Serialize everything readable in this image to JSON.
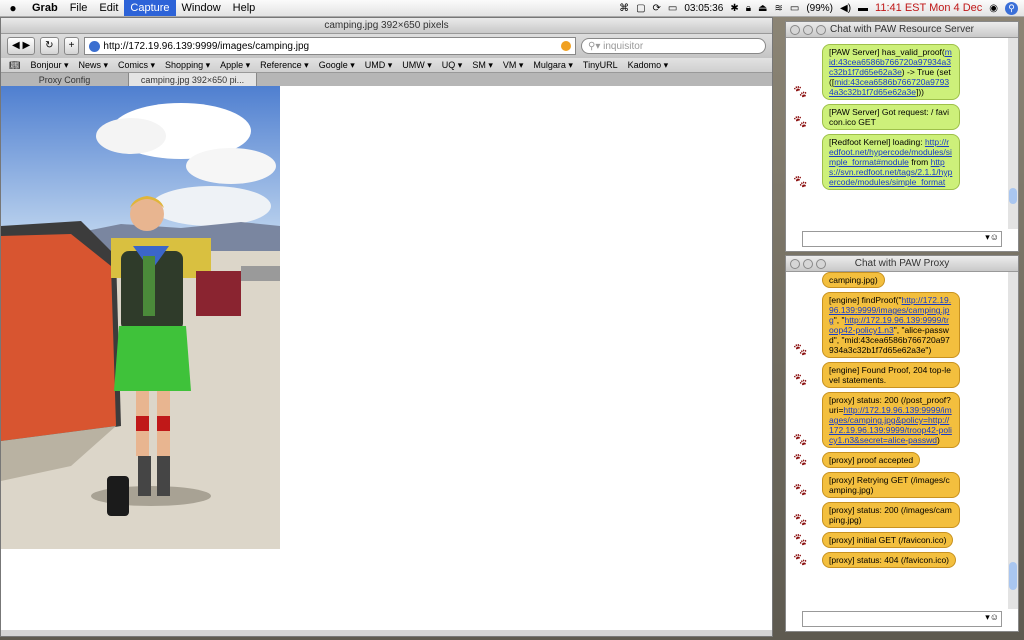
{
  "menubar": {
    "app": "Grab",
    "items": [
      "File",
      "Edit",
      "Capture",
      "Window",
      "Help"
    ],
    "selected_index": 2,
    "time_counter": "03:05:36",
    "battery": "(99%)",
    "clock": "11:41 EST Mon 4 Dec"
  },
  "browser": {
    "title": "camping.jpg 392×650 pixels",
    "url": "http://172.19.96.139:9999/images/camping.jpg",
    "search_placeholder": "inquisitor",
    "bookmarks": [
      "Bonjour ▾",
      "News ▾",
      "Comics ▾",
      "Shopping ▾",
      "Apple ▾",
      "Reference ▾",
      "Google ▾",
      "UMD ▾",
      "UMW ▾",
      "UQ ▾",
      "SM ▾",
      "VM ▾",
      "Mulgara ▾",
      "TinyURL",
      "Kadomo ▾"
    ],
    "tabs": [
      "Proxy Config",
      "camping.jpg 392×650 pi..."
    ],
    "active_tab": 1
  },
  "chat_server": {
    "title": "Chat with PAW Resource Server",
    "messages": [
      {
        "pre": "[PAW Server] has_valid_proof(",
        "link": "mid:43cea6586b766720a97934a3c32b1f7d65e62a3e",
        "post": ") -> True (set([",
        "link2": "mid:43cea6586b766720a97934a3c32b1f7d65e62a3e",
        "post2": "]))"
      },
      {
        "pre": "[PAW Server] Got request: / favicon.ico GET",
        "link": "",
        "post": "",
        "link2": "",
        "post2": ""
      },
      {
        "pre": "[Redfoot Kernel] loading: ",
        "link": "http://redfoot.net/hypercode/modules/simple_format#module",
        "post": " from ",
        "link2": "https://svn.redfoot.net/tags/2.1.1/hypercode/modules/simple_format",
        "post2": ""
      }
    ]
  },
  "chat_proxy": {
    "title": "Chat with PAW Proxy",
    "messages": [
      {
        "pre": "camping.jpg)",
        "link": "",
        "post": "",
        "link2": "",
        "post2": ""
      },
      {
        "pre": "[engine] findProof(\"",
        "link": "http://172.19.96.139:9999/images/camping.jpg",
        "post": "\", \"",
        "link2": "http://172.19.96.139:9999/troop42-policy1.n3",
        "post2": "\", \"alice-passwd\", \"mid:43cea6586b766720a97934a3c32b1f7d65e62a3e\")"
      },
      {
        "pre": "[engine] Found Proof, 204 top-level statements.",
        "link": "",
        "post": "",
        "link2": "",
        "post2": ""
      },
      {
        "pre": "[proxy] status: 200 (/post_proof?uri=",
        "link": "http://172.19.96.139:9999/images/camping.jpg&policy=http://172.19.96.139:9999/troop42-policy1.n3&secret=alice-passwd",
        "post": ")",
        "link2": "",
        "post2": ""
      },
      {
        "pre": "[proxy] proof accepted",
        "link": "",
        "post": "",
        "link2": "",
        "post2": ""
      },
      {
        "pre": "[proxy] Retrying GET (/images/camping.jpg)",
        "link": "",
        "post": "",
        "link2": "",
        "post2": ""
      },
      {
        "pre": "[proxy] status: 200 (/images/camping.jpg)",
        "link": "",
        "post": "",
        "link2": "",
        "post2": ""
      },
      {
        "pre": "[proxy] initial GET (/favicon.ico)",
        "link": "",
        "post": "",
        "link2": "",
        "post2": ""
      },
      {
        "pre": "[proxy] status: 404 (/favicon.ico)",
        "link": "",
        "post": "",
        "link2": "",
        "post2": ""
      }
    ]
  },
  "colors": {
    "green_bubble": "#cdf07a",
    "orange_bubble": "#f3bf3e",
    "link": "#1a3cc8",
    "paw": "#8b1010"
  }
}
